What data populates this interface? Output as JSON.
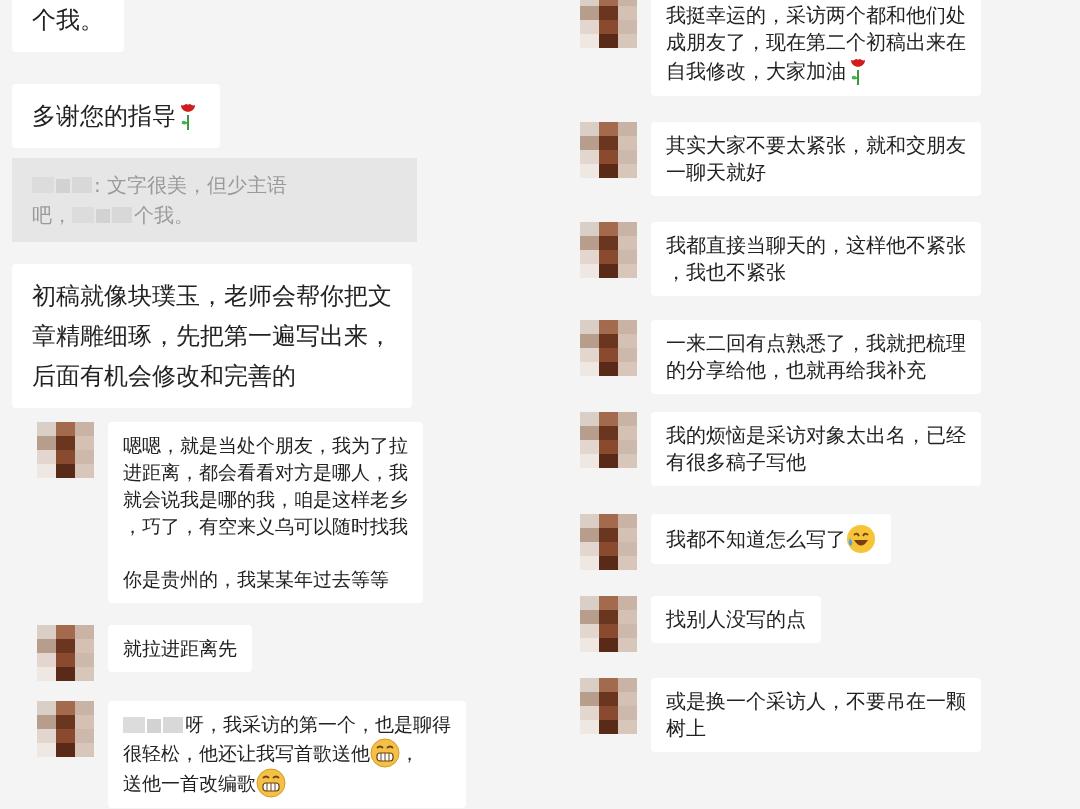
{
  "columns": [
    {
      "messages": [
        {
          "kind": "self",
          "lines": [
            {
              "parts": [
                {
                  "kind": "text",
                  "text": "个我。"
                }
              ]
            }
          ]
        },
        {
          "kind": "self",
          "lines": [
            {
              "parts": [
                {
                  "kind": "text",
                  "text": "多谢您的指导"
                },
                {
                  "kind": "rose"
                }
              ]
            }
          ]
        },
        {
          "kind": "quote",
          "lines": [
            {
              "parts": [
                {
                  "kind": "blur"
                },
                {
                  "kind": "text",
                  "text": ": 文字很美，但少主语"
                }
              ]
            },
            {
              "parts": [
                {
                  "kind": "text",
                  "text": "吧，"
                },
                {
                  "kind": "blur"
                },
                {
                  "kind": "text",
                  "text": "个我。"
                }
              ]
            }
          ]
        },
        {
          "kind": "self",
          "lines": [
            {
              "parts": [
                {
                  "kind": "text",
                  "text": "初稿就像块璞玉，老师会帮你把文"
                }
              ]
            },
            {
              "parts": [
                {
                  "kind": "text",
                  "text": "章精雕细琢，先把第一遍写出来，"
                }
              ]
            },
            {
              "parts": [
                {
                  "kind": "text",
                  "text": "后面有机会修改和完善的"
                }
              ]
            }
          ]
        },
        {
          "kind": "avatar",
          "lines": [
            {
              "parts": [
                {
                  "kind": "text",
                  "text": "嗯嗯，就是当处个朋友，我为了拉"
                }
              ]
            },
            {
              "parts": [
                {
                  "kind": "text",
                  "text": "进距离，都会看看对方是哪人，我"
                }
              ]
            },
            {
              "parts": [
                {
                  "kind": "text",
                  "text": "就会说我是哪的我，咱是这样老乡"
                }
              ]
            },
            {
              "parts": [
                {
                  "kind": "text",
                  "text": "，巧了，有空来义乌可以随时找我"
                }
              ]
            },
            {
              "parts": [
                {
                  "kind": "blank"
                }
              ]
            },
            {
              "parts": [
                {
                  "kind": "text",
                  "text": "你是贵州的，我某某年过去等等"
                }
              ]
            }
          ]
        },
        {
          "kind": "avatar",
          "lines": [
            {
              "parts": [
                {
                  "kind": "text",
                  "text": "就拉进距离先"
                }
              ]
            }
          ]
        },
        {
          "kind": "avatar",
          "lines": [
            {
              "parts": [
                {
                  "kind": "blur"
                },
                {
                  "kind": "text",
                  "text": "呀，我采访的第一个，也是聊得"
                }
              ]
            },
            {
              "parts": [
                {
                  "kind": "text",
                  "text": "很轻松，他还让我写首歌送他"
                },
                {
                  "kind": "grin"
                },
                {
                  "kind": "text",
                  "text": "，"
                }
              ]
            },
            {
              "parts": [
                {
                  "kind": "text",
                  "text": "送他一首改编歌"
                },
                {
                  "kind": "grin"
                }
              ]
            }
          ]
        }
      ]
    },
    {
      "messages": [
        {
          "kind": "avatar",
          "lines": [
            {
              "parts": [
                {
                  "kind": "text",
                  "text": "我挺幸运的，采访两个都和他们处"
                }
              ]
            },
            {
              "parts": [
                {
                  "kind": "text",
                  "text": "成朋友了，现在第二个初稿出来在"
                }
              ]
            },
            {
              "parts": [
                {
                  "kind": "text",
                  "text": "自我修改，大家加油"
                },
                {
                  "kind": "rose"
                }
              ]
            }
          ]
        },
        {
          "kind": "avatar",
          "lines": [
            {
              "parts": [
                {
                  "kind": "text",
                  "text": "其实大家不要太紧张，就和交朋友"
                }
              ]
            },
            {
              "parts": [
                {
                  "kind": "text",
                  "text": "一聊天就好"
                }
              ]
            }
          ]
        },
        {
          "kind": "avatar",
          "lines": [
            {
              "parts": [
                {
                  "kind": "text",
                  "text": "我都直接当聊天的，这样他不紧张"
                }
              ]
            },
            {
              "parts": [
                {
                  "kind": "text",
                  "text": "，我也不紧张"
                }
              ]
            }
          ]
        },
        {
          "kind": "avatar",
          "lines": [
            {
              "parts": [
                {
                  "kind": "text",
                  "text": "一来二回有点熟悉了，我就把梳理"
                }
              ]
            },
            {
              "parts": [
                {
                  "kind": "text",
                  "text": "的分享给他，也就再给我补充"
                }
              ]
            }
          ]
        },
        {
          "kind": "avatar",
          "lines": [
            {
              "parts": [
                {
                  "kind": "text",
                  "text": "我的烦恼是采访对象太出名，已经"
                }
              ]
            },
            {
              "parts": [
                {
                  "kind": "text",
                  "text": "有很多稿子写他"
                }
              ]
            }
          ]
        },
        {
          "kind": "avatar",
          "lines": [
            {
              "parts": [
                {
                  "kind": "text",
                  "text": "我都不知道怎么写了"
                },
                {
                  "kind": "laugh"
                }
              ]
            }
          ]
        },
        {
          "kind": "avatar",
          "lines": [
            {
              "parts": [
                {
                  "kind": "text",
                  "text": "找别人没写的点"
                }
              ]
            }
          ]
        },
        {
          "kind": "avatar",
          "lines": [
            {
              "parts": [
                {
                  "kind": "text",
                  "text": "或是换一个采访人，不要吊在一颗"
                }
              ]
            },
            {
              "parts": [
                {
                  "kind": "text",
                  "text": "树上"
                }
              ]
            }
          ]
        }
      ]
    }
  ]
}
